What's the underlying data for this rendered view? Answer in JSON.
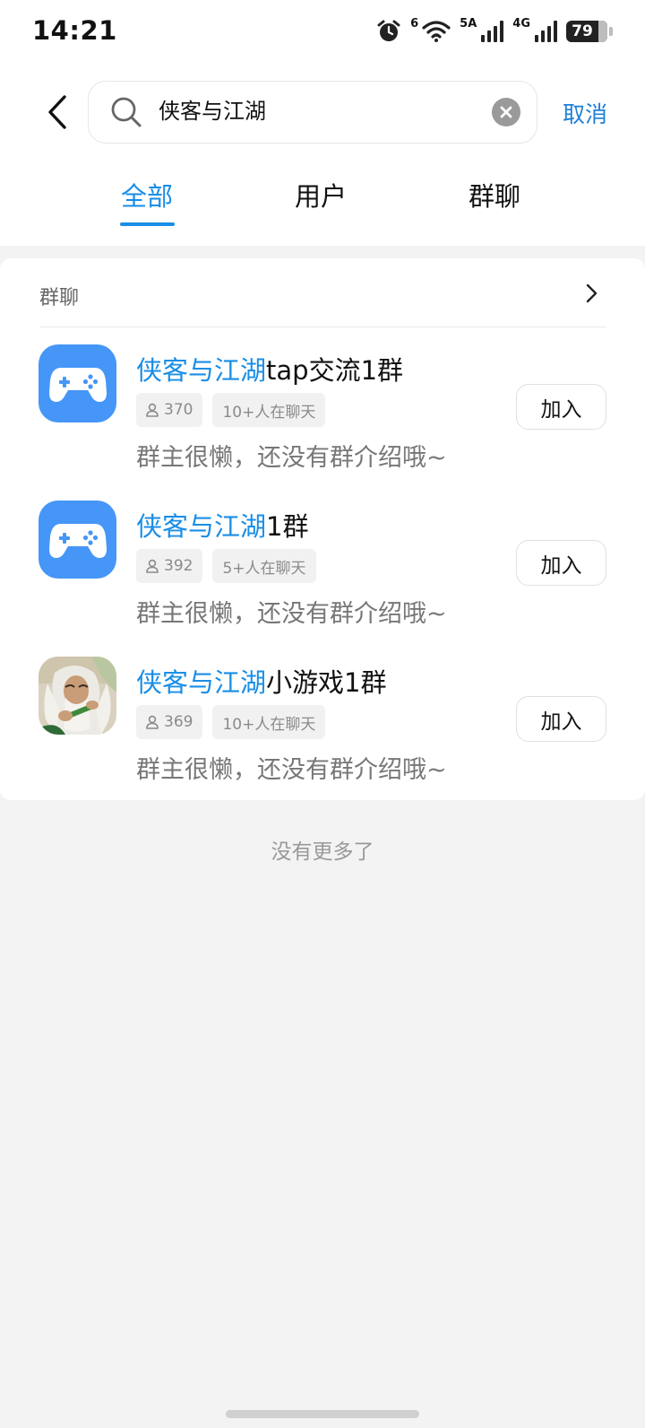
{
  "status_bar": {
    "time": "14:21",
    "wifi_label": "6",
    "signal1_label": "5A",
    "signal2_label": "4G",
    "battery": "79",
    "icons": [
      "alarm-icon",
      "wifi-icon",
      "signal-icon",
      "signal-icon",
      "battery-icon"
    ]
  },
  "header": {
    "search_value": "侠客与江湖",
    "cancel_label": "取消"
  },
  "tabs": [
    {
      "label": "全部",
      "active": true
    },
    {
      "label": "用户",
      "active": false
    },
    {
      "label": "群聊",
      "active": false
    }
  ],
  "section": {
    "title": "群聊"
  },
  "groups": [
    {
      "name_highlight": "侠客与江湖",
      "name_rest": "tap交流1群",
      "members": "370",
      "chatting": "10+人在聊天",
      "description": "群主很懒，还没有群介绍哦~",
      "join_label": "加入",
      "avatar": "gamepad-icon"
    },
    {
      "name_highlight": "侠客与江湖",
      "name_rest": "1群",
      "members": "392",
      "chatting": "5+人在聊天",
      "description": "群主很懒，还没有群介绍哦~",
      "join_label": "加入",
      "avatar": "gamepad-icon"
    },
    {
      "name_highlight": "侠客与江湖",
      "name_rest": "小游戏1群",
      "members": "369",
      "chatting": "10+人在聊天",
      "description": "群主很懒，还没有群介绍哦~",
      "join_label": "加入",
      "avatar": "character-illustration"
    }
  ],
  "footer": {
    "no_more": "没有更多了"
  },
  "colors": {
    "accent": "#1a8ee6",
    "cancel": "#1e7fd8",
    "avatar_blue": "#4596f7"
  }
}
